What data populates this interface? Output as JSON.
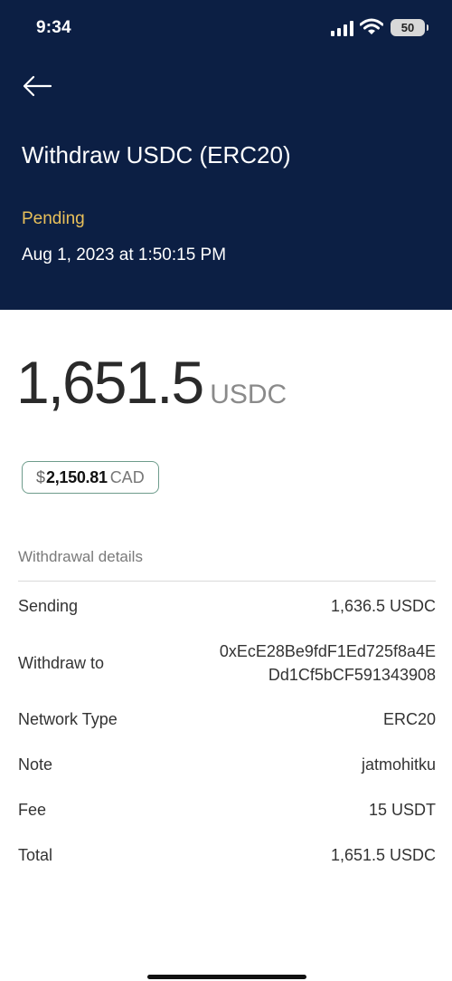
{
  "status_bar": {
    "time": "9:34",
    "battery": "50"
  },
  "header": {
    "title": "Withdraw USDC (ERC20)",
    "status": "Pending",
    "datetime": "Aug 1, 2023 at 1:50:15 PM"
  },
  "amount": {
    "value": "1,651.5",
    "unit": "USDC"
  },
  "fiat": {
    "symbol": "$",
    "amount": "2,150.81",
    "currency": "CAD"
  },
  "details": {
    "title": "Withdrawal details",
    "rows": [
      {
        "label": "Sending",
        "value": "1,636.5 USDC"
      },
      {
        "label": "Withdraw to",
        "value_line1": "0xEcE28Be9fdF1Ed725f8a4E",
        "value_line2": "Dd1Cf5bCF591343908"
      },
      {
        "label": "Network Type",
        "value": "ERC20"
      },
      {
        "label": "Note",
        "value": "jatmohitku"
      },
      {
        "label": "Fee",
        "value": "15 USDT"
      },
      {
        "label": "Total",
        "value": "1,651.5 USDC"
      }
    ]
  },
  "colors": {
    "header_bg": "#0c1f44",
    "pending": "#e9c05a",
    "badge_border": "#6e9c8c"
  }
}
